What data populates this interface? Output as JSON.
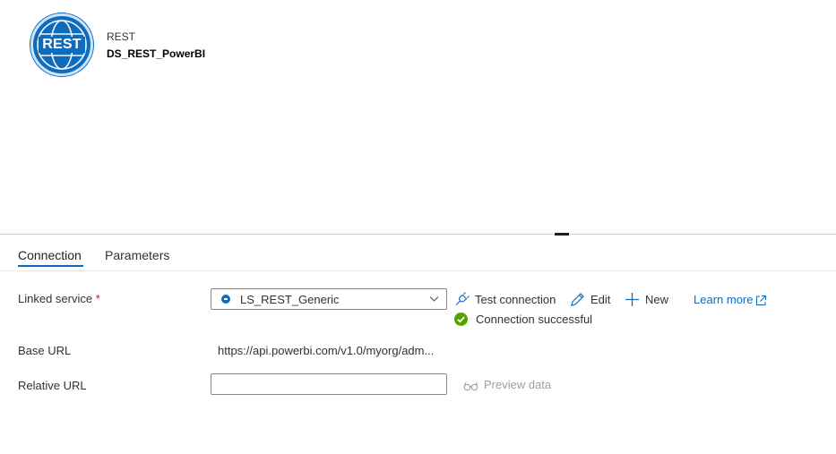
{
  "header": {
    "icon_text": "REST",
    "dataset_type": "REST",
    "dataset_name": "DS_REST_PowerBI"
  },
  "tabs": [
    {
      "label": "Connection",
      "active": true
    },
    {
      "label": "Parameters",
      "active": false
    }
  ],
  "form": {
    "linked_service": {
      "label": "Linked service",
      "required_mark": "*",
      "value": "LS_REST_Generic"
    },
    "actions": {
      "test_connection": "Test connection",
      "edit": "Edit",
      "new": "New",
      "learn_more": "Learn more"
    },
    "status": "Connection successful",
    "base_url": {
      "label": "Base URL",
      "value": "https://api.powerbi.com/v1.0/myorg/adm..."
    },
    "relative_url": {
      "label": "Relative URL",
      "value": "",
      "placeholder": ""
    },
    "preview_data": "Preview data"
  },
  "colors": {
    "accent": "#0f6cbd",
    "success": "#57a300",
    "required": "#a4262c",
    "disabled_text": "#a19f9d"
  }
}
